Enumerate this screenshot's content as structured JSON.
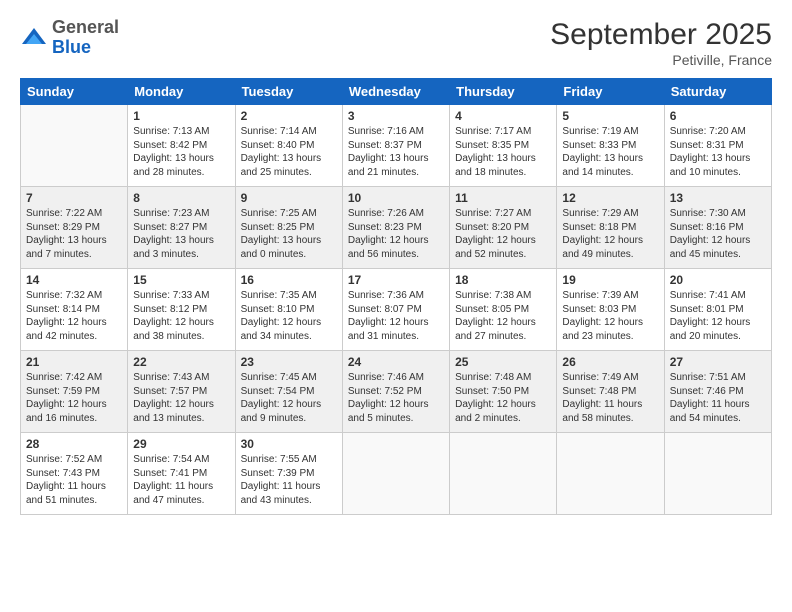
{
  "header": {
    "logo_general": "General",
    "logo_blue": "Blue",
    "month_title": "September 2025",
    "location": "Petiville, France"
  },
  "weekdays": [
    "Sunday",
    "Monday",
    "Tuesday",
    "Wednesday",
    "Thursday",
    "Friday",
    "Saturday"
  ],
  "weeks": [
    [
      {
        "day": "",
        "info": ""
      },
      {
        "day": "1",
        "info": "Sunrise: 7:13 AM\nSunset: 8:42 PM\nDaylight: 13 hours\nand 28 minutes."
      },
      {
        "day": "2",
        "info": "Sunrise: 7:14 AM\nSunset: 8:40 PM\nDaylight: 13 hours\nand 25 minutes."
      },
      {
        "day": "3",
        "info": "Sunrise: 7:16 AM\nSunset: 8:37 PM\nDaylight: 13 hours\nand 21 minutes."
      },
      {
        "day": "4",
        "info": "Sunrise: 7:17 AM\nSunset: 8:35 PM\nDaylight: 13 hours\nand 18 minutes."
      },
      {
        "day": "5",
        "info": "Sunrise: 7:19 AM\nSunset: 8:33 PM\nDaylight: 13 hours\nand 14 minutes."
      },
      {
        "day": "6",
        "info": "Sunrise: 7:20 AM\nSunset: 8:31 PM\nDaylight: 13 hours\nand 10 minutes."
      }
    ],
    [
      {
        "day": "7",
        "info": "Sunrise: 7:22 AM\nSunset: 8:29 PM\nDaylight: 13 hours\nand 7 minutes."
      },
      {
        "day": "8",
        "info": "Sunrise: 7:23 AM\nSunset: 8:27 PM\nDaylight: 13 hours\nand 3 minutes."
      },
      {
        "day": "9",
        "info": "Sunrise: 7:25 AM\nSunset: 8:25 PM\nDaylight: 13 hours\nand 0 minutes."
      },
      {
        "day": "10",
        "info": "Sunrise: 7:26 AM\nSunset: 8:23 PM\nDaylight: 12 hours\nand 56 minutes."
      },
      {
        "day": "11",
        "info": "Sunrise: 7:27 AM\nSunset: 8:20 PM\nDaylight: 12 hours\nand 52 minutes."
      },
      {
        "day": "12",
        "info": "Sunrise: 7:29 AM\nSunset: 8:18 PM\nDaylight: 12 hours\nand 49 minutes."
      },
      {
        "day": "13",
        "info": "Sunrise: 7:30 AM\nSunset: 8:16 PM\nDaylight: 12 hours\nand 45 minutes."
      }
    ],
    [
      {
        "day": "14",
        "info": "Sunrise: 7:32 AM\nSunset: 8:14 PM\nDaylight: 12 hours\nand 42 minutes."
      },
      {
        "day": "15",
        "info": "Sunrise: 7:33 AM\nSunset: 8:12 PM\nDaylight: 12 hours\nand 38 minutes."
      },
      {
        "day": "16",
        "info": "Sunrise: 7:35 AM\nSunset: 8:10 PM\nDaylight: 12 hours\nand 34 minutes."
      },
      {
        "day": "17",
        "info": "Sunrise: 7:36 AM\nSunset: 8:07 PM\nDaylight: 12 hours\nand 31 minutes."
      },
      {
        "day": "18",
        "info": "Sunrise: 7:38 AM\nSunset: 8:05 PM\nDaylight: 12 hours\nand 27 minutes."
      },
      {
        "day": "19",
        "info": "Sunrise: 7:39 AM\nSunset: 8:03 PM\nDaylight: 12 hours\nand 23 minutes."
      },
      {
        "day": "20",
        "info": "Sunrise: 7:41 AM\nSunset: 8:01 PM\nDaylight: 12 hours\nand 20 minutes."
      }
    ],
    [
      {
        "day": "21",
        "info": "Sunrise: 7:42 AM\nSunset: 7:59 PM\nDaylight: 12 hours\nand 16 minutes."
      },
      {
        "day": "22",
        "info": "Sunrise: 7:43 AM\nSunset: 7:57 PM\nDaylight: 12 hours\nand 13 minutes."
      },
      {
        "day": "23",
        "info": "Sunrise: 7:45 AM\nSunset: 7:54 PM\nDaylight: 12 hours\nand 9 minutes."
      },
      {
        "day": "24",
        "info": "Sunrise: 7:46 AM\nSunset: 7:52 PM\nDaylight: 12 hours\nand 5 minutes."
      },
      {
        "day": "25",
        "info": "Sunrise: 7:48 AM\nSunset: 7:50 PM\nDaylight: 12 hours\nand 2 minutes."
      },
      {
        "day": "26",
        "info": "Sunrise: 7:49 AM\nSunset: 7:48 PM\nDaylight: 11 hours\nand 58 minutes."
      },
      {
        "day": "27",
        "info": "Sunrise: 7:51 AM\nSunset: 7:46 PM\nDaylight: 11 hours\nand 54 minutes."
      }
    ],
    [
      {
        "day": "28",
        "info": "Sunrise: 7:52 AM\nSunset: 7:43 PM\nDaylight: 11 hours\nand 51 minutes."
      },
      {
        "day": "29",
        "info": "Sunrise: 7:54 AM\nSunset: 7:41 PM\nDaylight: 11 hours\nand 47 minutes."
      },
      {
        "day": "30",
        "info": "Sunrise: 7:55 AM\nSunset: 7:39 PM\nDaylight: 11 hours\nand 43 minutes."
      },
      {
        "day": "",
        "info": ""
      },
      {
        "day": "",
        "info": ""
      },
      {
        "day": "",
        "info": ""
      },
      {
        "day": "",
        "info": ""
      }
    ]
  ]
}
